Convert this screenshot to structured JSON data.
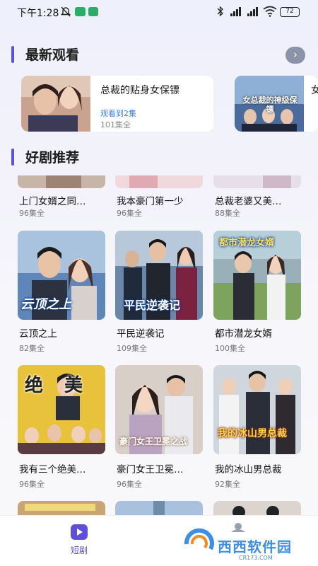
{
  "status_bar": {
    "time": "下午1:28",
    "battery": "72",
    "icons": [
      "mute-icon",
      "wechat-icon",
      "send-icon",
      "bluetooth-icon",
      "signal-icon",
      "signal-icon",
      "wifi-icon",
      "battery-icon"
    ],
    "accent": "#2aae67"
  },
  "recent": {
    "title": "最新观看",
    "more_icon": "chevron-right-icon",
    "items": [
      {
        "title": "总裁的贴身女保镖",
        "progress": "观看到2集",
        "total": "101集全"
      },
      {
        "title": "女",
        "poster_text": "女总裁的神级保镖"
      }
    ]
  },
  "recommend": {
    "title": "好剧推荐",
    "rows": [
      [
        {
          "title": "上门女婿之同…",
          "count": "96集全"
        },
        {
          "title": "我本豪门第一少",
          "count": "96集全"
        },
        {
          "title": "总裁老婆又美…",
          "count": "88集全"
        }
      ],
      [
        {
          "title": "云顶之上",
          "count": "82集全",
          "poster_text": "云顶之上"
        },
        {
          "title": "平民逆袭记",
          "count": "109集全",
          "poster_text": "平民逆袭记"
        },
        {
          "title": "都市潜龙女婿",
          "count": "100集全",
          "poster_text": "都市潜龙女婿"
        }
      ],
      [
        {
          "title": "我有三个绝美…",
          "count": "96集全",
          "poster_text": "绝美"
        },
        {
          "title": "豪门女王卫冕…",
          "count": "96集全",
          "poster_text": "豪门女王卫冕之战"
        },
        {
          "title": "我的冰山男总裁",
          "count": "92集全",
          "poster_text": "我的冰山男总裁"
        }
      ]
    ]
  },
  "bottom_nav": {
    "items": [
      {
        "label": "短剧",
        "icon": "play-tv-icon",
        "active_color": "#5c4fd9"
      }
    ]
  },
  "watermark": {
    "text": "西西软件园",
    "sub": "CR173.COM"
  },
  "colors": {
    "accent": "#5b53d6",
    "link": "#3d7ff0"
  }
}
